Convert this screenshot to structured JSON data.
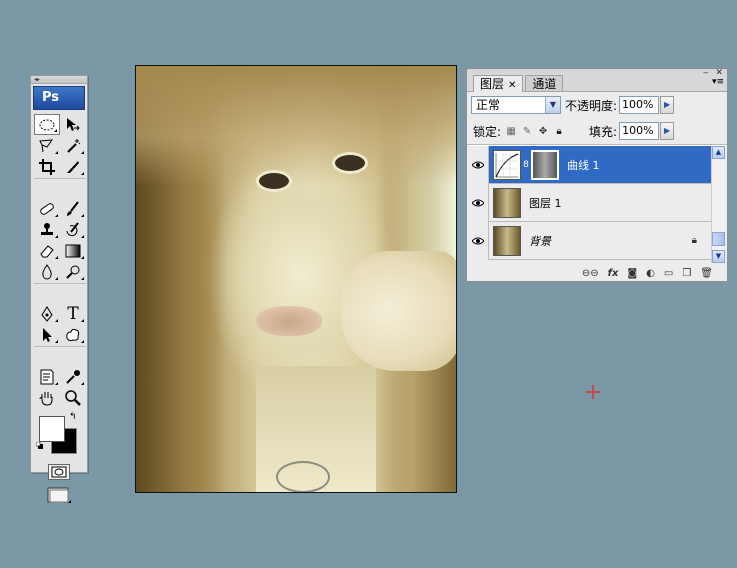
{
  "toolbox": {
    "logo": "Ps",
    "tools": [
      {
        "name": "elliptical-marquee-tool",
        "icon": "ellipse-dashed-icon",
        "selected": true
      },
      {
        "name": "move-tool",
        "icon": "move-arrow-icon"
      },
      {
        "name": "polygonal-lasso-tool",
        "icon": "lasso-icon"
      },
      {
        "name": "magic-wand-tool",
        "icon": "magic-wand-icon"
      },
      {
        "name": "crop-tool",
        "icon": "crop-icon"
      },
      {
        "name": "slice-tool",
        "icon": "slice-knife-icon"
      },
      {
        "name": "healing-brush-tool",
        "icon": "bandage-icon"
      },
      {
        "name": "brush-tool",
        "icon": "brush-icon"
      },
      {
        "name": "clone-stamp-tool",
        "icon": "stamp-icon"
      },
      {
        "name": "history-brush-tool",
        "icon": "history-brush-icon"
      },
      {
        "name": "eraser-tool",
        "icon": "eraser-icon"
      },
      {
        "name": "gradient-tool",
        "icon": "gradient-icon"
      },
      {
        "name": "blur-tool",
        "icon": "drop-icon"
      },
      {
        "name": "dodge-tool",
        "icon": "dodge-icon"
      },
      {
        "name": "pen-tool",
        "icon": "pen-icon"
      },
      {
        "name": "type-tool",
        "icon": "type-t-icon",
        "glyph": "T"
      },
      {
        "name": "path-selection-tool",
        "icon": "path-arrow-icon"
      },
      {
        "name": "custom-shape-tool",
        "icon": "shape-blob-icon"
      },
      {
        "name": "notes-tool",
        "icon": "note-icon"
      },
      {
        "name": "eyedropper-tool",
        "icon": "eyedropper-icon"
      },
      {
        "name": "hand-tool",
        "icon": "hand-icon"
      },
      {
        "name": "zoom-tool",
        "icon": "magnifier-icon"
      }
    ],
    "foreground_color": "#ffffff",
    "background_color": "#000000"
  },
  "layers_panel": {
    "tabs": [
      {
        "label": "图层",
        "closable": true,
        "active": true
      },
      {
        "label": "通道",
        "closable": false,
        "active": false
      }
    ],
    "blend_mode": "正常",
    "opacity_label": "不透明度:",
    "opacity_value": "100%",
    "lock_label": "锁定:",
    "fill_label": "填充:",
    "fill_value": "100%",
    "layers": [
      {
        "name": "曲线 1",
        "type": "adjustment",
        "selected": true,
        "visible": true
      },
      {
        "name": "图层 1",
        "type": "pixel",
        "selected": false,
        "visible": true
      },
      {
        "name": "背景",
        "type": "background",
        "selected": false,
        "visible": true,
        "locked": true
      }
    ],
    "footer_icons": [
      "link-icon",
      "fx-icon",
      "mask-icon",
      "adjustment-icon",
      "folder-icon",
      "new-layer-icon",
      "trash-icon"
    ],
    "fx_label": "fx"
  },
  "colors": {
    "desktop": "#7b98a6",
    "selection": "#316ac5",
    "crosshair": "#e02020"
  }
}
